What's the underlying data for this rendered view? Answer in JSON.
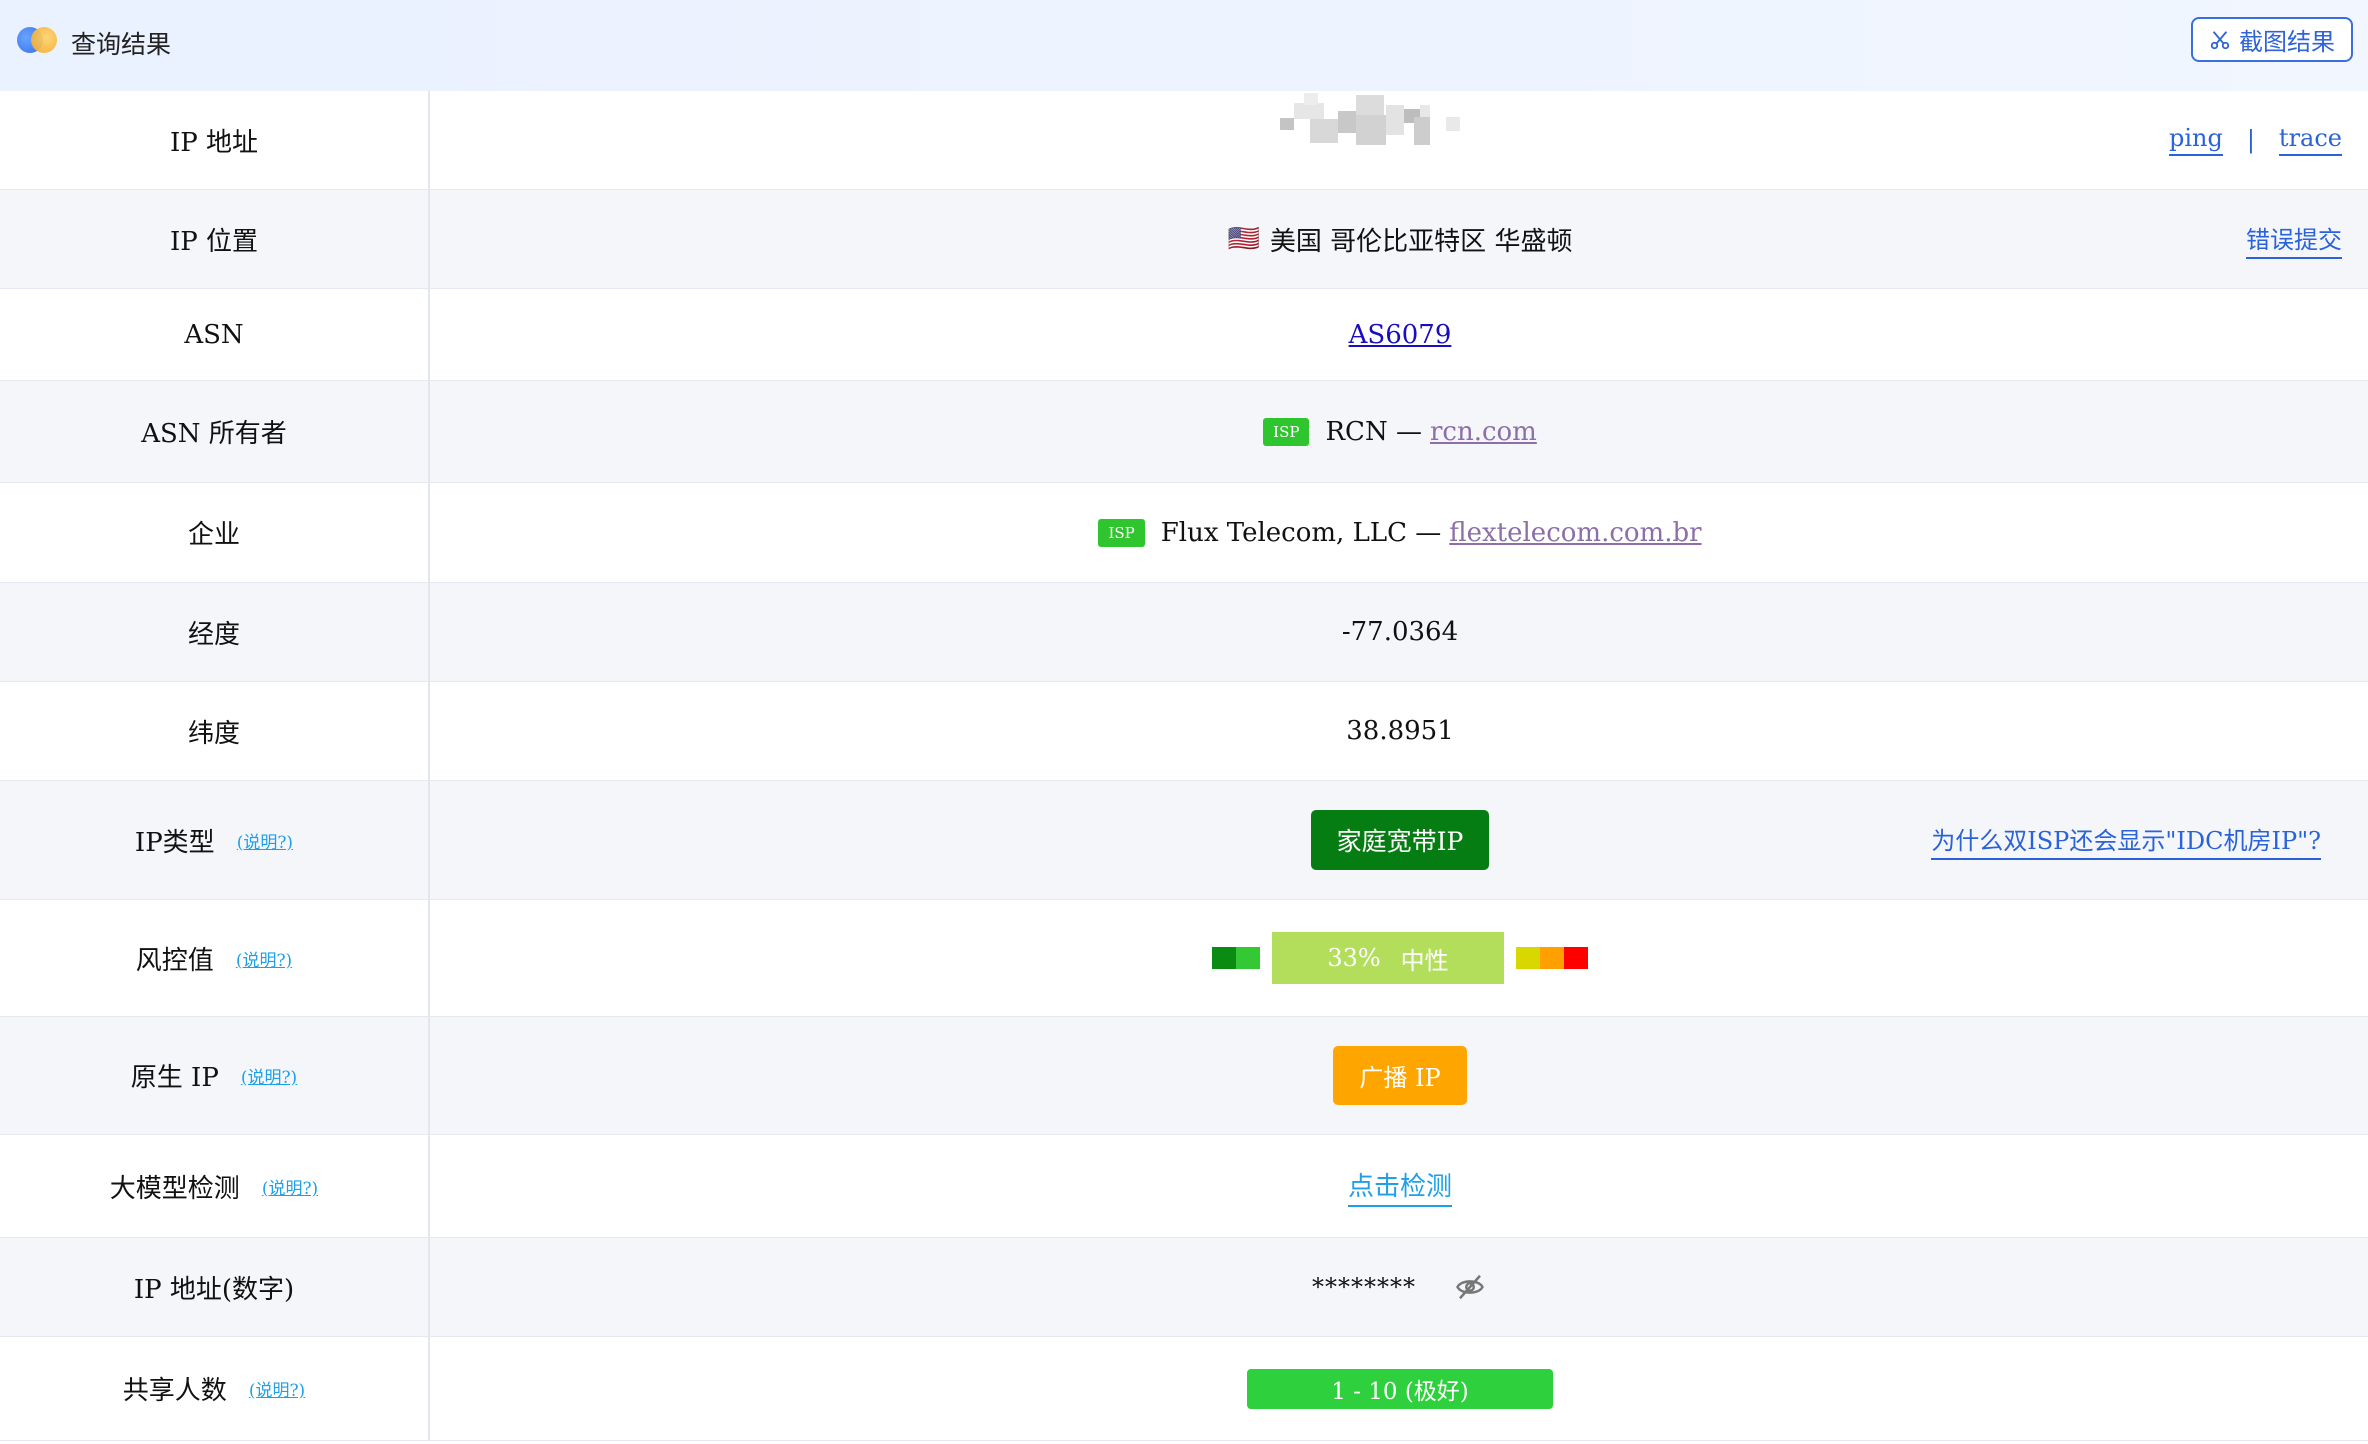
{
  "header": {
    "title": "查询结果",
    "screenshot_button": "截图结果"
  },
  "rows": {
    "ip": {
      "label": "IP 地址",
      "ping": "ping",
      "sep": "|",
      "trace": "trace"
    },
    "location": {
      "label": "IP 位置",
      "flag": "🇺🇸",
      "value": "美国 哥伦比亚特区 华盛顿",
      "report": "错误提交"
    },
    "asn": {
      "label": "ASN",
      "value": "AS6079"
    },
    "asn_owner": {
      "label": "ASN 所有者",
      "badge": "ISP",
      "name": "RCN —",
      "domain": "rcn.com"
    },
    "company": {
      "label": "企业",
      "badge": "ISP",
      "name": "Flux Telecom, LLC —",
      "domain": "flextelecom.com.br"
    },
    "longitude": {
      "label": "经度",
      "value": "-77.0364"
    },
    "latitude": {
      "label": "纬度",
      "value": "38.8951"
    },
    "ip_type": {
      "label": "IP类型",
      "help": "(说明?)",
      "value": "家庭宽带IP",
      "why": "为什么双ISP还会显示\"IDC机房IP\"?"
    },
    "risk": {
      "label": "风控值",
      "help": "(说明?)",
      "percent": "33%",
      "level": "中性",
      "score": 0.33
    },
    "native": {
      "label": "原生 IP",
      "help": "(说明?)",
      "value": "广播 IP"
    },
    "llm": {
      "label": "大模型检测",
      "help": "(说明?)",
      "value": "点击检测"
    },
    "ip_numeric": {
      "label": "IP 地址(数字)",
      "value": "********"
    },
    "shared": {
      "label": "共享人数",
      "help": "(说明?)",
      "value": "1 - 10 (极好)"
    }
  },
  "colors": {
    "accent_blue": "#2a62db",
    "help_blue": "#1ea0e8",
    "isp_green": "#2fc52f",
    "type_green": "#067d12",
    "risk_neutral": "#b3de5b",
    "native_orange": "#ffa500",
    "share_green": "#2fd03d"
  },
  "icons": [
    "logo-icon",
    "scissors-icon",
    "flag-icon",
    "eye-off-icon"
  ]
}
